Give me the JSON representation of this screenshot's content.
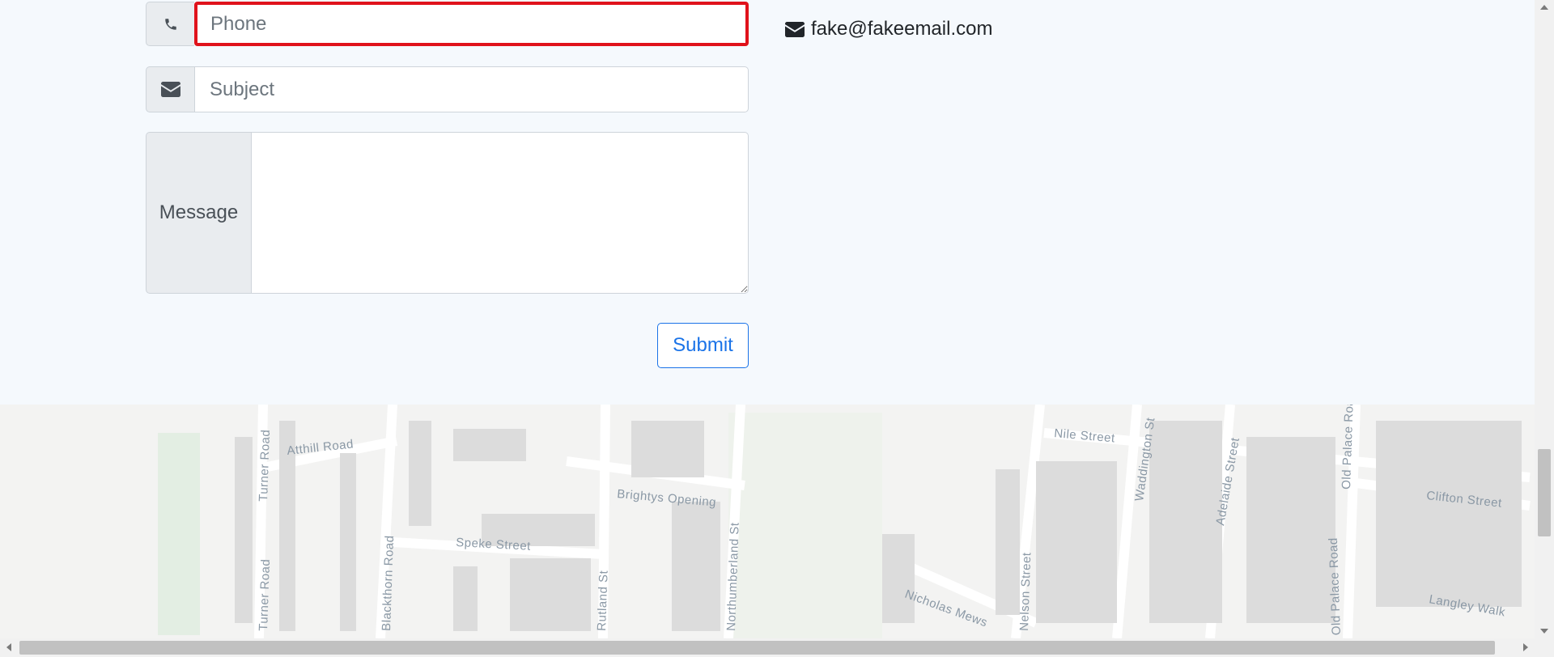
{
  "form": {
    "phone": {
      "icon": "phone-icon",
      "placeholder": "Phone",
      "value": ""
    },
    "subject": {
      "icon": "envelope-icon",
      "placeholder": "Subject",
      "value": ""
    },
    "message": {
      "label": "Message",
      "value": ""
    },
    "submit_label": "Submit"
  },
  "contact": {
    "email_icon": "envelope-icon",
    "email": "fake@fakeemail.com"
  },
  "map": {
    "streets": [
      "Atthill Road",
      "Turner Road",
      "Turner Road",
      "Speke Street",
      "Brightys Opening",
      "Blackthorn Road",
      "Rutland St",
      "Northumberland St",
      "Nicholas Mews",
      "Nelson Street",
      "Nile Street",
      "Waddington St",
      "Adelaide Street",
      "Old Palace Road",
      "Old Palace Road",
      "Clifton Street",
      "Langley Walk"
    ]
  },
  "colors": {
    "accent": "#1a73e8",
    "focus_border": "#e0121b",
    "page_bg": "#f5f9fd"
  }
}
